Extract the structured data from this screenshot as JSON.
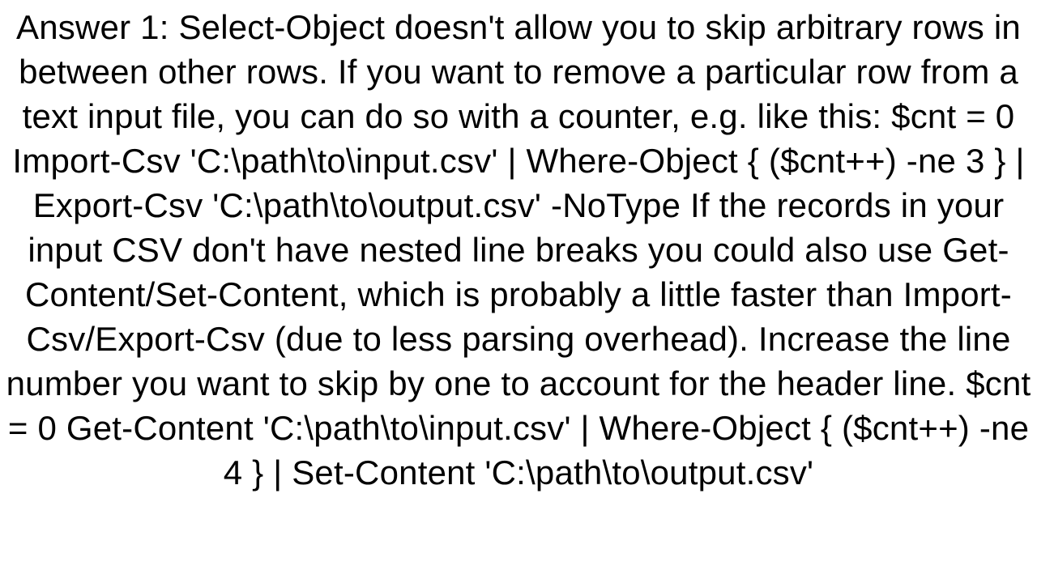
{
  "answer": {
    "text": "Answer 1: Select-Object doesn't allow you to skip arbitrary rows in between other rows. If you want to remove a particular row from a text input file, you can do so with a counter, e.g. like this: $cnt = 0 Import-Csv 'C:\\path\\to\\input.csv' |   Where-Object { ($cnt++) -ne 3 } |   Export-Csv 'C:\\path\\to\\output.csv' -NoType  If the records in your input CSV don't have nested line breaks you could also use Get-Content/Set-Content, which is probably a little faster than Import-Csv/Export-Csv (due to less parsing overhead). Increase the line number you want to skip by one to account for the header line. $cnt = 0 Get-Content 'C:\\path\\to\\input.csv' |   Where-Object { ($cnt++) -ne 4 } |   Set-Content 'C:\\path\\to\\output.csv'"
  }
}
